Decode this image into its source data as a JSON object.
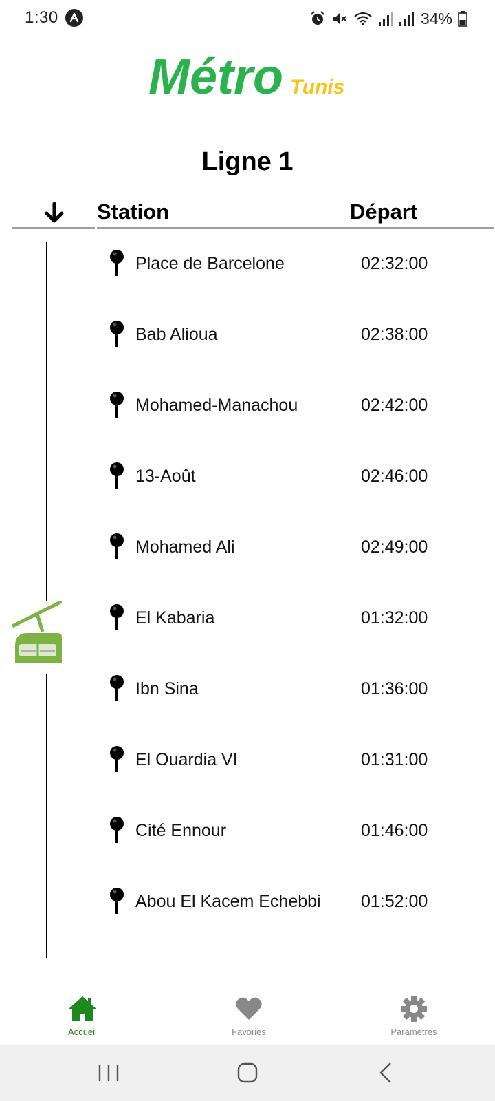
{
  "status_bar": {
    "time": "1:30",
    "battery_percent": "34%",
    "icons": [
      "app-notification-icon",
      "alarm-icon",
      "mute-icon",
      "wifi-icon",
      "signal-icon",
      "signal-icon",
      "battery-icon"
    ]
  },
  "app": {
    "logo_text_main": "Métro",
    "logo_text_sub": "Tunis",
    "brand_green": "#2bb24c",
    "brand_yellow": "#f5c518"
  },
  "schedule": {
    "title": "Ligne 1",
    "sort_icon": "arrow-down-icon",
    "columns": {
      "station": "Station",
      "departure": "Départ"
    },
    "stations": [
      {
        "name": "Place de Barcelone",
        "time": "02:32:00"
      },
      {
        "name": "Bab Alioua",
        "time": "02:38:00"
      },
      {
        "name": "Mohamed-Manachou",
        "time": "02:42:00"
      },
      {
        "name": "13-Août",
        "time": "02:46:00"
      },
      {
        "name": "Mohamed Ali",
        "time": "02:49:00"
      },
      {
        "name": "El Kabaria",
        "time": "01:32:00"
      },
      {
        "name": "Ibn Sina",
        "time": "01:36:00"
      },
      {
        "name": "El Ouardia VI",
        "time": "01:31:00"
      },
      {
        "name": "Cité Ennour",
        "time": "01:46:00"
      },
      {
        "name": "Abou El Kacem Echebbi",
        "time": "01:52:00"
      }
    ],
    "current_station_index": 5,
    "vehicle_icon": "cable-car-icon"
  },
  "bottom_nav": {
    "items": [
      {
        "label": "Accueil",
        "icon": "home-icon",
        "active": true
      },
      {
        "label": "Favories",
        "icon": "heart-icon",
        "active": false
      },
      {
        "label": "Paramètres",
        "icon": "gear-icon",
        "active": false
      }
    ],
    "active_color": "#1e8a1e",
    "inactive_color": "#888888"
  }
}
